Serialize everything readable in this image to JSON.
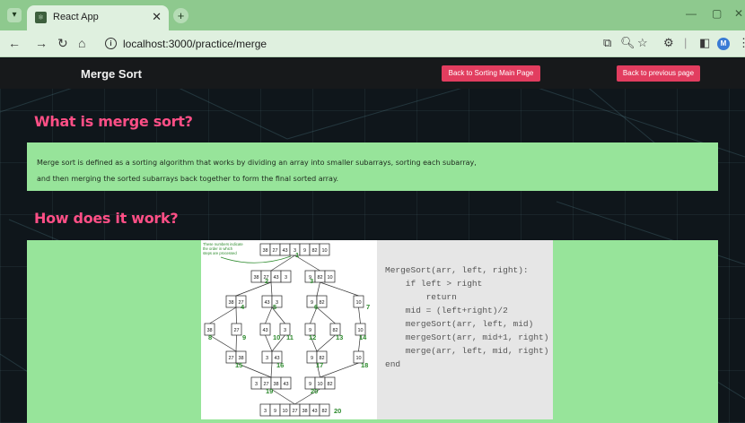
{
  "browser": {
    "tab_title": "React App",
    "favicon_glyph": "⚛",
    "url": "localhost:3000/practice/merge",
    "profile_initial": "M"
  },
  "navbar": {
    "brand": "Merge Sort",
    "back_sorting_label": "Back to Sorting Main Page",
    "back_previous_label": "Back to previous page",
    "accent_color": "#e23d5f"
  },
  "sections": {
    "what_title": "What is merge sort?",
    "what_line1": "Merge sort is defined as a sorting algorithm that works by dividing an array into smaller subarrays, sorting each subarray,",
    "what_line2": "and then merging the sorted subarrays back together to form the final sorted array.",
    "how_title": "How does it work?"
  },
  "diagram": {
    "note": [
      "These numbers indicate",
      "the order in which",
      "steps are processed"
    ],
    "nodes": [
      {
        "values": [
          "38",
          "27",
          "43",
          "3",
          "9",
          "82",
          "10"
        ]
      },
      {
        "values": [
          "38",
          "27",
          "43",
          "3"
        ]
      },
      {
        "values": [
          "9",
          "82",
          "10"
        ]
      },
      {
        "values": [
          "38",
          "27"
        ]
      },
      {
        "values": [
          "43",
          "3"
        ]
      },
      {
        "values": [
          "9",
          "82"
        ]
      },
      {
        "values": [
          "10"
        ]
      },
      {
        "values": [
          "38"
        ]
      },
      {
        "values": [
          "27"
        ]
      },
      {
        "values": [
          "43"
        ]
      },
      {
        "values": [
          "3"
        ]
      },
      {
        "values": [
          "9"
        ]
      },
      {
        "values": [
          "82"
        ]
      },
      {
        "values": [
          "10"
        ]
      },
      {
        "values": [
          "27",
          "38"
        ]
      },
      {
        "values": [
          "3",
          "43"
        ]
      },
      {
        "values": [
          "9",
          "82"
        ]
      },
      {
        "values": [
          "10"
        ]
      },
      {
        "values": [
          "3",
          "27",
          "38",
          "43"
        ]
      },
      {
        "values": [
          "9",
          "10",
          "82"
        ]
      },
      {
        "values": [
          "3",
          "9",
          "10",
          "27",
          "38",
          "43",
          "82"
        ]
      }
    ],
    "step_labels": [
      "1",
      "2",
      "3",
      "4",
      "5",
      "6",
      "7",
      "8",
      "9",
      "10",
      "11",
      "12",
      "13",
      "14",
      "15",
      "16",
      "17",
      "18",
      "19",
      "20"
    ],
    "step_color": "#2e8b2e"
  },
  "code": {
    "lines": [
      "MergeSort(arr, left, right):",
      "    if left > right",
      "        return",
      "    mid = (left+right)/2",
      "    mergeSort(arr, left, mid)",
      "    mergeSort(arr, mid+1, right)",
      "    merge(arr, left, mid, right)",
      "end"
    ]
  }
}
